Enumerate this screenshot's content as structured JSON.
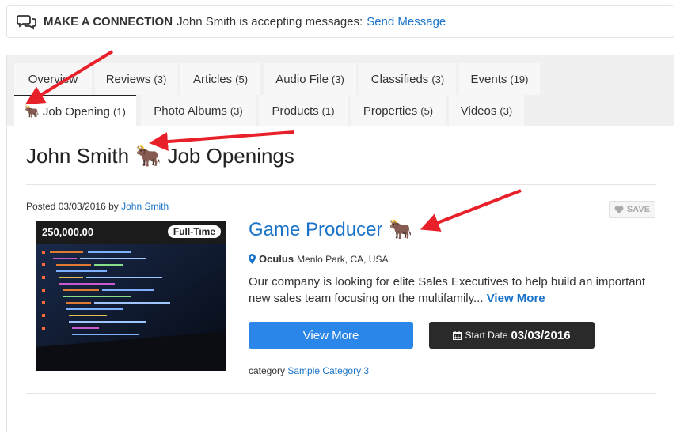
{
  "connect": {
    "heading": "MAKE A CONNECTION",
    "text": "John Smith is accepting messages:",
    "link": "Send Message",
    "icon": "chat-bubbles-icon"
  },
  "tabs_row1": [
    {
      "label": "Overview",
      "count": ""
    },
    {
      "label": "Reviews",
      "count": "(3)"
    },
    {
      "label": "Articles",
      "count": "(5)"
    },
    {
      "label": "Audio File",
      "count": "(3)"
    },
    {
      "label": "Classifieds",
      "count": "(3)"
    },
    {
      "label": "Events",
      "count": "(19)"
    }
  ],
  "tabs_row2": [
    {
      "label": "Job Opening",
      "count": "(1)",
      "emoji": "🐂",
      "active": true
    },
    {
      "label": "Photo Albums",
      "count": "(3)"
    },
    {
      "label": "Products",
      "count": "(1)"
    },
    {
      "label": "Properties",
      "count": "(5)"
    },
    {
      "label": "Videos",
      "count": "(3)"
    }
  ],
  "page_title": {
    "name": "John Smith",
    "emoji": "🐂",
    "suffix": "Job Openings"
  },
  "listing": {
    "posted_prefix": "Posted 03/03/2016 by",
    "posted_author": "John Smith",
    "save_label": "SAVE",
    "price": "250,000.00",
    "badge": "Full-Time",
    "title": "Game Producer",
    "title_emoji": "🐂",
    "company": "Oculus",
    "location": "Menlo Park, CA, USA",
    "description": "Our company is looking for elite Sales Executives to help build an important new sales team focusing on the multifamily...",
    "description_link": "View More",
    "view_more_button": "View More",
    "start_label": "Start Date",
    "start_date": "03/03/2016",
    "category_label": "category",
    "category_value": "Sample Category 3"
  },
  "colors": {
    "link": "#1a73c8",
    "primary_button": "#2a86e8",
    "dark_button": "#2a2a2a",
    "arrow": "#e8202a"
  }
}
